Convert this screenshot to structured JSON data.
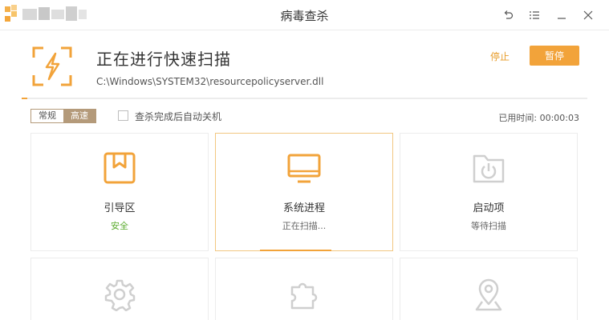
{
  "window": {
    "title": "病毒查杀"
  },
  "scan": {
    "title": "正在进行快速扫描",
    "current_file": "C:\\Windows\\SYSTEM32\\resourcepolicyserver.dll",
    "stop_label": "停止",
    "pause_label": "暂停",
    "progress": 0.01
  },
  "options": {
    "mode_normal": "常规",
    "mode_fast": "高速",
    "selected_mode": "高速",
    "auto_shutdown_label": "查杀完成后自动关机",
    "auto_shutdown_checked": false,
    "elapsed_label": "已用时间:",
    "elapsed_value": "00:00:03"
  },
  "cards": [
    {
      "name": "引导区",
      "status": "安全",
      "icon": "bookmark-box-icon",
      "state": "done"
    },
    {
      "name": "系统进程",
      "status": "正在扫描...",
      "icon": "monitor-icon",
      "state": "scanning",
      "progress": 0.4
    },
    {
      "name": "启动项",
      "status": "等待扫描",
      "icon": "power-folder-icon",
      "state": "waiting"
    },
    {
      "name": "",
      "status": "",
      "icon": "gear-icon",
      "state": "waiting"
    },
    {
      "name": "",
      "status": "",
      "icon": "puzzle-icon",
      "state": "waiting"
    },
    {
      "name": "",
      "status": "",
      "icon": "location-pin-icon",
      "state": "waiting"
    }
  ],
  "colors": {
    "accent": "#f2a33a",
    "safe": "#5aab2d",
    "segment": "#b49a7a",
    "inactive_icon": "#cfcfcf"
  }
}
